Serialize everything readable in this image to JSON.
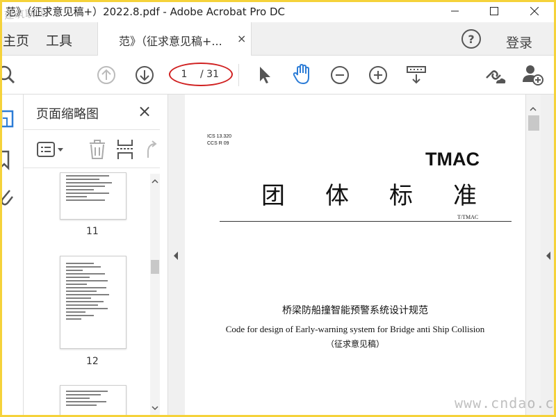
{
  "window": {
    "title": "范》（征求意见稿+）2022.8.pdf - Adobe Acrobat Pro DC",
    "watermark_top": "建筑联网"
  },
  "tabs": {
    "home": "主页",
    "tools": "工具",
    "document": "范》（征求意见稿+...",
    "close": "×",
    "help": "?",
    "login": "登录"
  },
  "toolbar": {
    "current_page": "1",
    "total_pages": "/ 31"
  },
  "panel": {
    "title": "页面缩略图",
    "close": "×",
    "thumbnails": [
      {
        "label": "11"
      },
      {
        "label": "12"
      }
    ]
  },
  "document": {
    "ics": "ICS 13.320",
    "ccs": "CCS R 09",
    "tmac": "TMAC",
    "standard_title_chars": [
      "团",
      "体",
      "标",
      "准"
    ],
    "t_tmac": "T/TMAC",
    "title_cn": "桥梁防船撞智能预警系统设计规范",
    "title_en": "Code for design of  Early-warning system for Bridge anti Ship Collision",
    "draft_note": "（征求意见稿）"
  },
  "watermark_bottom": "www.cndao.com",
  "colors": {
    "accent_blue": "#2c7cd6",
    "highlight_red": "#d02020",
    "frame_yellow": "#f5d23a"
  }
}
